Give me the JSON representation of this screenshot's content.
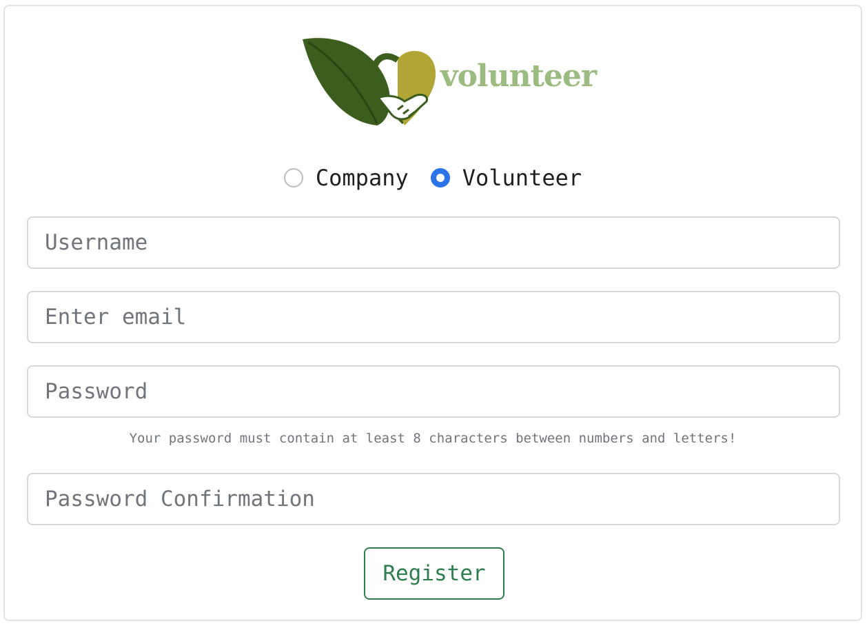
{
  "logo": {
    "text": "volunteer",
    "icon": "leaf-heart-handshake-icon"
  },
  "account_type": {
    "options": [
      {
        "label": "Company",
        "checked": false
      },
      {
        "label": "Volunteer",
        "checked": true
      }
    ]
  },
  "form": {
    "username_placeholder": "Username",
    "email_placeholder": "Enter email",
    "password_placeholder": "Password",
    "password_hint": "Your password must contain at least 8 characters between numbers and letters!",
    "password_confirm_placeholder": "Password Confirmation",
    "register_label": "Register"
  },
  "colors": {
    "accent_blue": "#2b73e6",
    "register_green": "#2e7d4f",
    "logo_dark_green": "#3b5e1e",
    "logo_olive": "#b0a535",
    "logo_text_green": "#8ab06b"
  }
}
